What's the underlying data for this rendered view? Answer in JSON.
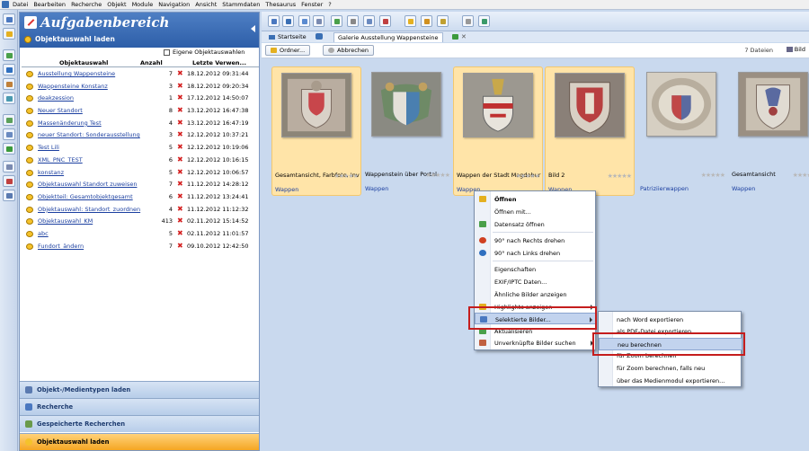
{
  "menu": [
    "Datei",
    "Bearbeiten",
    "Recherche",
    "Objekt",
    "Module",
    "Navigation",
    "Ansicht",
    "Stammdaten",
    "Thesaurus",
    "Fenster",
    "?"
  ],
  "left_panel": {
    "title": "Aufgabenbereich",
    "subtitle": "Objektauswahl laden",
    "checkbox_label": "Eigene Objektauswahlen",
    "columns": {
      "name": "Objektauswahl",
      "count": "Anzahl",
      "date": "Letzte Verwen..."
    },
    "rows": [
      {
        "name": "Ausstellung Wappensteine",
        "count": "7",
        "date": "18.12.2012 09:31:44"
      },
      {
        "name": "Wappensteine Konstanz",
        "count": "3",
        "date": "18.12.2012 09:20:34"
      },
      {
        "name": "deakzession",
        "count": "1",
        "date": "17.12.2012 14:50:07"
      },
      {
        "name": "Neuer Standort",
        "count": "8",
        "date": "13.12.2012 16:47:38"
      },
      {
        "name": "Massenänderung Test",
        "count": "4",
        "date": "13.12.2012 16:47:19"
      },
      {
        "name": "neuer Standort: Sonderausstellung",
        "count": "3",
        "date": "12.12.2012 10:37:21"
      },
      {
        "name": "Test Lili",
        "count": "5",
        "date": "12.12.2012 10:19:06"
      },
      {
        "name": "XML_PNC_TEST",
        "count": "6",
        "date": "12.12.2012 10:16:15"
      },
      {
        "name": "konstanz",
        "count": "5",
        "date": "12.12.2012 10:06:57"
      },
      {
        "name": "Objektauswahl Standort zuweisen",
        "count": "7",
        "date": "11.12.2012 14:28:12"
      },
      {
        "name": "Objektteil: Gesamtobjektgesamt",
        "count": "6",
        "date": "11.12.2012 13:24:41"
      },
      {
        "name": "Objektauswahl: Standort_zuordnen",
        "count": "4",
        "date": "11.12.2012 11:12:32"
      },
      {
        "name": "Objektauswahl_KM",
        "count": "413",
        "date": "02.11.2012 15:14:52"
      },
      {
        "name": "abc",
        "count": "5",
        "date": "02.11.2012 11:01:57"
      },
      {
        "name": "Fundort_ändern",
        "count": "7",
        "date": "09.10.2012 12:42:50"
      }
    ],
    "nav_buttons": [
      "Objekt-/Medientypen laden",
      "Recherche",
      "Gespeicherte Recherchen",
      "Objektauswahl laden"
    ]
  },
  "tabs": {
    "home": "Startseite",
    "gallery": "Galerie Ausstellung Wappensteine"
  },
  "actions": {
    "folder": "Ordner...",
    "cancel": "Abbrechen",
    "files": "7 Dateien",
    "view": "Bild"
  },
  "gallery": [
    {
      "caption": "Gesamtansicht, Farbfoto, Inv",
      "sub": "Wappen"
    },
    {
      "caption": "Wappenstein über Portal",
      "sub": "Wappen"
    },
    {
      "caption": "Wappen der Stadt Magdebur",
      "sub": "Wappen"
    },
    {
      "caption": "Bild 2",
      "sub": "Wappen"
    },
    {
      "caption": "",
      "sub": "Patriziierwappen"
    },
    {
      "caption": "Gesamtansicht",
      "sub": "Wappen"
    }
  ],
  "context_menu": [
    "Öffnen",
    "Öffnen mit...",
    "Datensatz öffnen",
    "90° nach Rechts drehen",
    "90° nach Links drehen",
    "Eigenschaften",
    "EXIF/IPTC Daten...",
    "Ähnliche Bilder anzeigen",
    "Highlights anzeigen",
    "Selektierte Bilder...",
    "Aktualisieren",
    "Unverknüpfte Bilder suchen"
  ],
  "submenu": [
    "nach Word exportieren",
    "als PDF-Datei exportieren",
    "neu berechnen",
    "für Zoom berechnen",
    "für Zoom berechnen, falls neu",
    "über das Medienmodul exportieren..."
  ]
}
